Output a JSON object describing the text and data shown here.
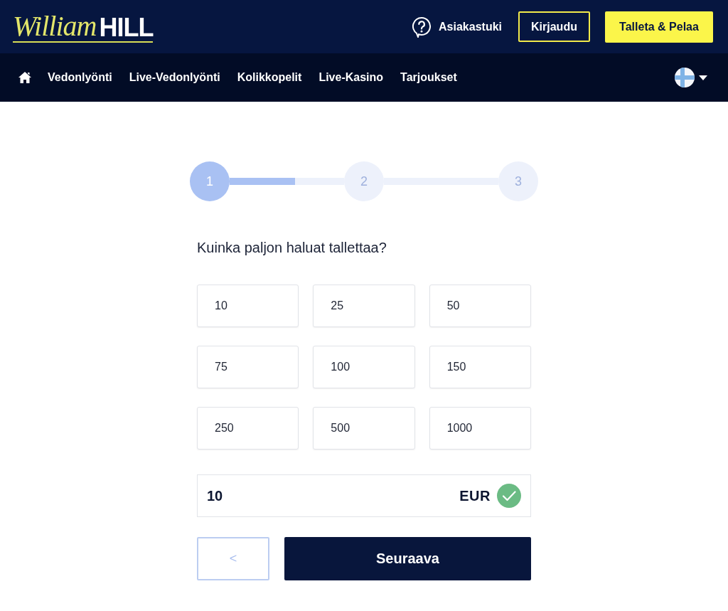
{
  "header": {
    "logo": {
      "script": "William",
      "wordmark": "HILL"
    },
    "support_link": "Asiakastuki",
    "login_button": "Kirjaudu",
    "deposit_button": "Talleta & Pelaa"
  },
  "nav": {
    "items": [
      {
        "label": "Vedonlyönti"
      },
      {
        "label": "Live-Vedonlyönti"
      },
      {
        "label": "Kolikkopelit"
      },
      {
        "label": "Live-Kasino"
      },
      {
        "label": "Tarjoukset"
      }
    ]
  },
  "stepper": {
    "steps": [
      {
        "label": "1",
        "selected": true
      },
      {
        "label": "2",
        "selected": false
      },
      {
        "label": "3",
        "selected": false
      }
    ],
    "level": 0.57
  },
  "question": "Kuinka paljon haluat tallettaa?",
  "amounts": [
    {
      "label": "10",
      "selected": false
    },
    {
      "label": "25",
      "selected": false
    },
    {
      "label": "50",
      "selected": false
    },
    {
      "label": "75",
      "selected": false
    },
    {
      "label": "100",
      "selected": false
    },
    {
      "label": "150",
      "selected": false
    },
    {
      "label": "250",
      "selected": false
    },
    {
      "label": "500",
      "selected": false
    },
    {
      "label": "1000",
      "selected": false
    }
  ],
  "amount_field": {
    "value": "10",
    "currency": "EUR",
    "valid": true
  },
  "buttons": {
    "back": "<",
    "next": "Seuraava"
  }
}
